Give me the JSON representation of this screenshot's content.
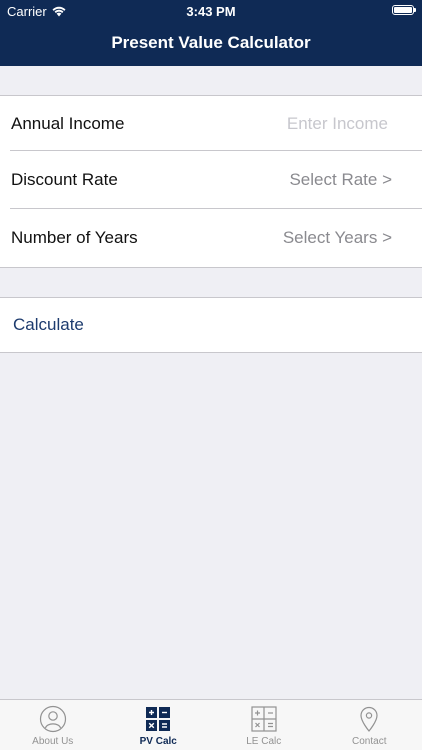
{
  "status_bar": {
    "carrier": "Carrier",
    "time": "3:43 PM"
  },
  "nav": {
    "title": "Present Value Calculator"
  },
  "form": {
    "annual_income": {
      "label": "Annual Income",
      "placeholder": "Enter Income"
    },
    "discount_rate": {
      "label": "Discount Rate",
      "value": "Select Rate >"
    },
    "number_of_years": {
      "label": "Number of Years",
      "value": "Select Years >"
    }
  },
  "actions": {
    "calculate_label": "Calculate"
  },
  "tabs": [
    {
      "label": "About Us",
      "icon": "person-icon",
      "active": false
    },
    {
      "label": "PV Calc",
      "icon": "calculator-icon",
      "active": true
    },
    {
      "label": "LE Calc",
      "icon": "calculator-icon",
      "active": false
    },
    {
      "label": "Contact",
      "icon": "location-pin-icon",
      "active": false
    }
  ],
  "colors": {
    "nav_background": "#0f2a55",
    "accent": "#1d3b6e",
    "page_background": "#efeff4",
    "inactive_tab": "#929292"
  }
}
